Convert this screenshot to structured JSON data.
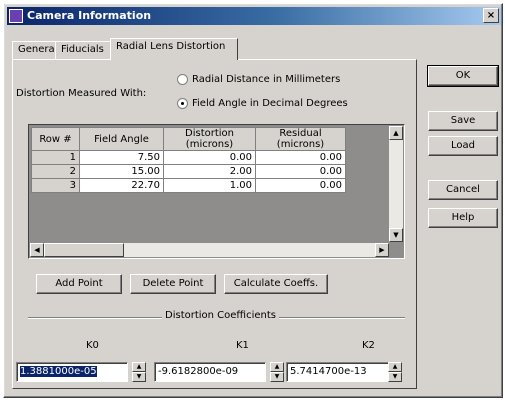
{
  "window": {
    "title": "Camera Information",
    "close_glyph": "×"
  },
  "tabs": [
    {
      "label": "General"
    },
    {
      "label": "Fiducials"
    },
    {
      "label": "Radial Lens Distortion"
    }
  ],
  "distortion": {
    "measured_with_label": "Distortion Measured With:",
    "option_radial": "Radial Distance in Millimeters",
    "option_field": "Field Angle in Decimal Degrees",
    "selected": "field"
  },
  "grid": {
    "headers": [
      "Row #",
      "Field Angle",
      "Distortion (microns)",
      "Residual (microns)"
    ],
    "rows": [
      {
        "row": "1",
        "field_angle": "7.50",
        "distortion": "0.00",
        "residual": "0.00"
      },
      {
        "row": "2",
        "field_angle": "15.00",
        "distortion": "2.00",
        "residual": "0.00"
      },
      {
        "row": "3",
        "field_angle": "22.70",
        "distortion": "1.00",
        "residual": "0.00"
      }
    ]
  },
  "actions": {
    "add_point": "Add Point",
    "delete_point": "Delete Point",
    "calculate": "Calculate Coeffs."
  },
  "coefficients": {
    "title": "Distortion Coefficients",
    "k0_label": "K0",
    "k0_value": "1.3881000e-05",
    "k1_label": "K1",
    "k1_value": "-9.6182800e-09",
    "k2_label": "K2",
    "k2_value": "5.7414700e-13"
  },
  "buttons": {
    "ok": "OK",
    "save": "Save",
    "load": "Load",
    "cancel": "Cancel",
    "help": "Help"
  },
  "icons": {
    "scroll_up": "▲",
    "scroll_down": "▼",
    "scroll_left": "◀",
    "scroll_right": "▶"
  }
}
